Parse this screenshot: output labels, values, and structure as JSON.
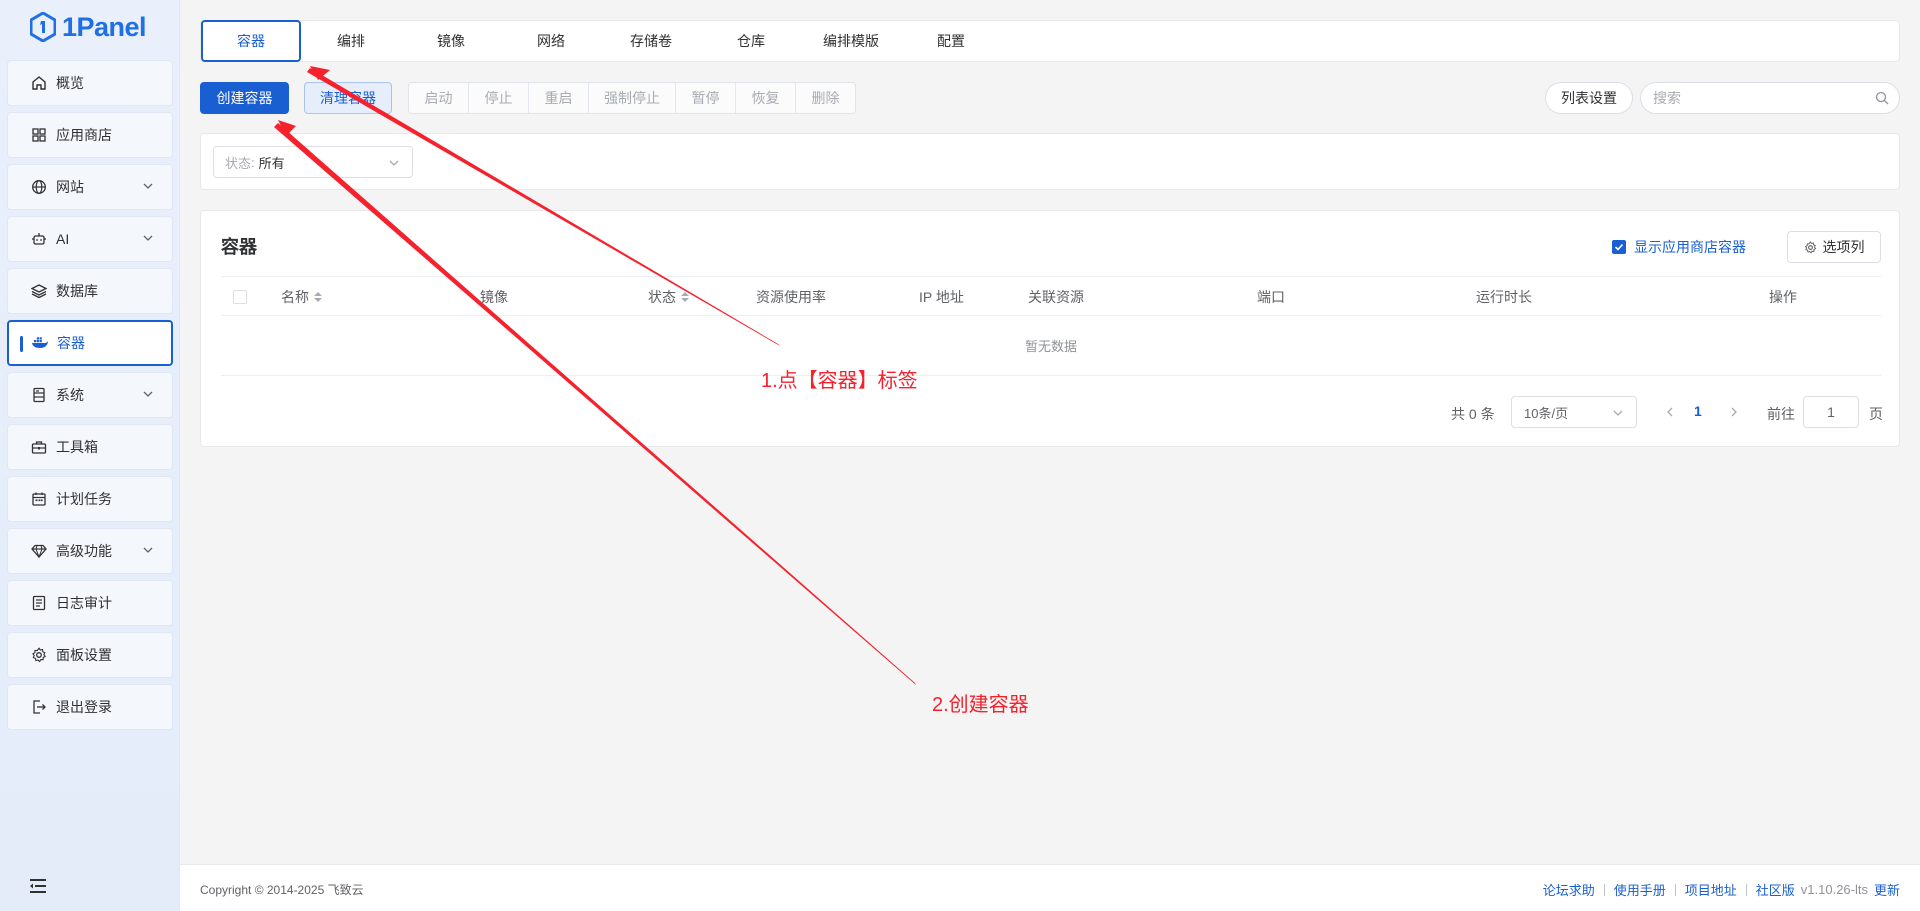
{
  "app": {
    "logo_text": "1Panel"
  },
  "sidebar": {
    "items": [
      {
        "label": "概览",
        "icon": "home-icon"
      },
      {
        "label": "应用商店",
        "icon": "grid-icon"
      },
      {
        "label": "网站",
        "icon": "globe-icon"
      },
      {
        "label": "AI",
        "icon": "robot-icon"
      },
      {
        "label": "数据库",
        "icon": "layers-icon"
      },
      {
        "label": "容器",
        "icon": "docker-icon"
      },
      {
        "label": "系统",
        "icon": "server-icon"
      },
      {
        "label": "工具箱",
        "icon": "toolbox-icon"
      },
      {
        "label": "计划任务",
        "icon": "calendar-icon"
      },
      {
        "label": "高级功能",
        "icon": "diamond-icon"
      },
      {
        "label": "日志审计",
        "icon": "log-icon"
      },
      {
        "label": "面板设置",
        "icon": "gear-icon"
      },
      {
        "label": "退出登录",
        "icon": "logout-icon"
      }
    ],
    "active_item": "容器"
  },
  "tabs": [
    "容器",
    "编排",
    "镜像",
    "网络",
    "存储卷",
    "仓库",
    "编排模版",
    "配置"
  ],
  "toolbar": {
    "create_label": "创建容器",
    "clean_label": "清理容器",
    "actions": [
      "启动",
      "停止",
      "重启",
      "强制停止",
      "暂停",
      "恢复",
      "删除"
    ],
    "list_settings_label": "列表设置",
    "search_placeholder": "搜索"
  },
  "filter": {
    "status_prefix": "状态",
    "status_value": "所有"
  },
  "table": {
    "title": "容器",
    "show_app_label": "显示应用商店容器",
    "columns_button_label": "选项列",
    "columns": [
      "名称",
      "镜像",
      "状态",
      "资源使用率",
      "IP 地址",
      "关联资源",
      "端口",
      "运行时长",
      "操作"
    ],
    "empty_text": "暂无数据"
  },
  "pagination": {
    "total_text": "共 0 条",
    "page_size": "10条/页",
    "current_page": "1",
    "goto_label": "前往",
    "goto_value": "1",
    "page_suffix": "页"
  },
  "footer": {
    "copyright": "Copyright © 2014-2025 飞致云",
    "links": [
      "论坛求助",
      "使用手册",
      "项目地址",
      "社区版"
    ],
    "version": "v1.10.26-lts",
    "update_label": "更新"
  },
  "annotations": {
    "step1": "1.点【容器】标签",
    "step2": "2.创建容器",
    "color": "#f5222d"
  },
  "colors": {
    "primary": "#1a5fd1",
    "sidebar_bg": "#e9effb"
  }
}
